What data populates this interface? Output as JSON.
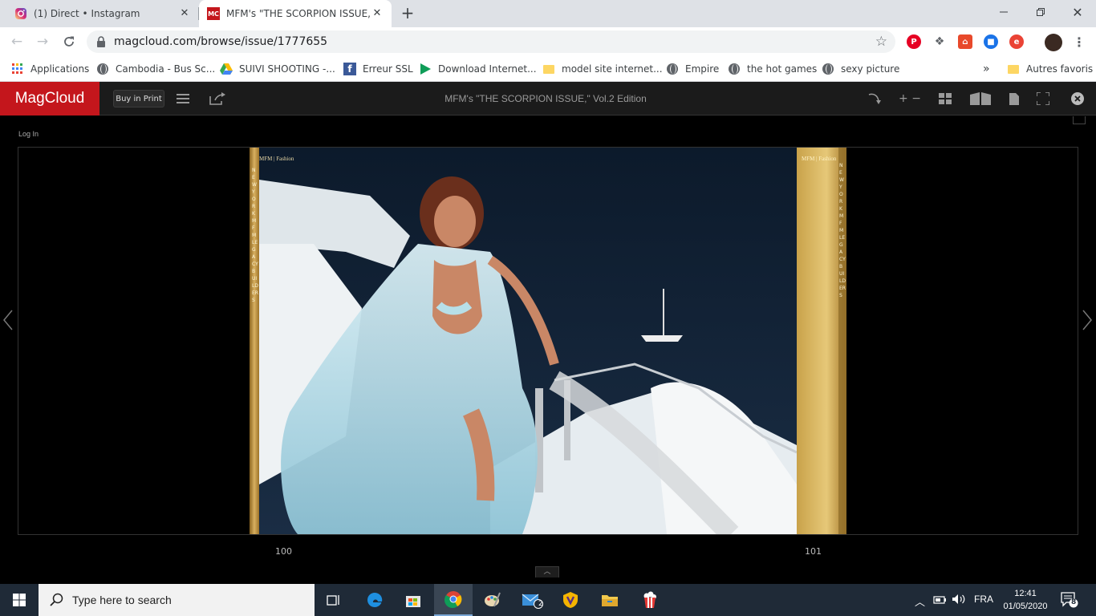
{
  "browser": {
    "tabs": [
      {
        "title": "(1) Direct • Instagram",
        "favicon": "instagram-icon"
      },
      {
        "title": "MFM's \"THE SCORPION ISSUE,\" V",
        "favicon": "magcloud-icon",
        "favicon_text": "MC"
      }
    ],
    "url": "magcloud.com/browse/issue/1777655",
    "bookmarks": [
      {
        "label": "Applications",
        "icon": "apps-grid-icon"
      },
      {
        "label": "Cambodia - Bus Sc...",
        "icon": "globe-icon"
      },
      {
        "label": "SUIVI SHOOTING -...",
        "icon": "google-drive-icon"
      },
      {
        "label": "Erreur SSL",
        "icon": "facebook-icon"
      },
      {
        "label": "Download Internet...",
        "icon": "play-icon"
      },
      {
        "label": "model site internet...",
        "icon": "folder-icon"
      },
      {
        "label": "Empire",
        "icon": "globe-icon"
      },
      {
        "label": "the hot games",
        "icon": "globe-icon"
      },
      {
        "label": "sexy picture",
        "icon": "globe-icon"
      }
    ],
    "bookmarks_overflow": "»",
    "other_bookmarks": "Autres favoris"
  },
  "magcloud": {
    "logo": "MagCloud",
    "buy_in_print": "Buy in Print",
    "title": "MFM's \"THE SCORPION ISSUE,\" Vol.2 Edition",
    "login": "Log In",
    "zoom_label": "+ −",
    "page_left": "100",
    "page_right": "101",
    "left_page_header": "MFM | Fashion",
    "right_page_header": "MFM | Fashion",
    "left_vertical_text": "NEW YORK MFM LEGACY BUILDERS",
    "right_vertical_text": "NEW YORK MFM LEGACY BUILDERS"
  },
  "taskbar": {
    "search_placeholder": "Type here to search",
    "mail_badge": "2",
    "language": "FRA",
    "time": "12:41",
    "date": "01/05/2020",
    "notifications": "8"
  },
  "colors": {
    "magcloud_red": "#c4161c",
    "gold_border": "#c9a24a",
    "taskbar": "#1f2a37"
  }
}
